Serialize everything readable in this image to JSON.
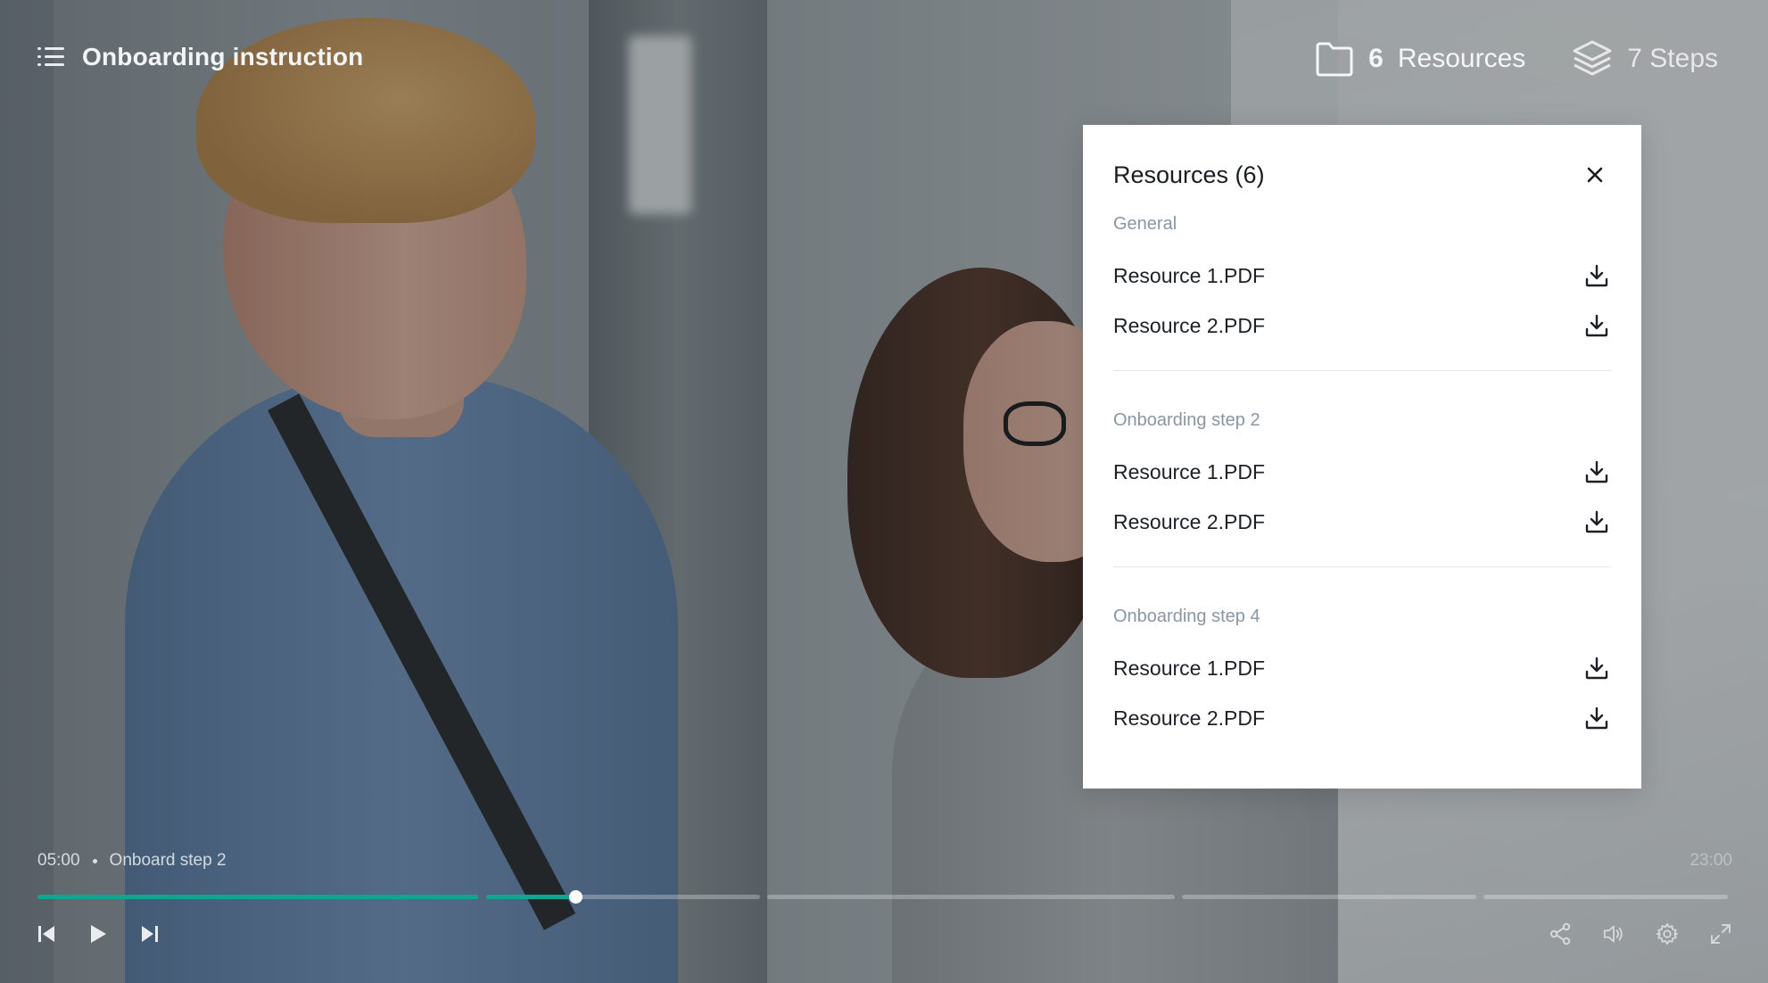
{
  "header": {
    "title": "Onboarding instruction",
    "resources_count": "6",
    "resources_label": "Resources",
    "steps_label": "7 Steps"
  },
  "panel": {
    "title": "Resources (6)",
    "groups": [
      {
        "label": "General",
        "items": [
          "Resource 1.PDF",
          "Resource 2.PDF"
        ]
      },
      {
        "label": "Onboarding step 2",
        "items": [
          "Resource 1.PDF",
          "Resource 2.PDF"
        ]
      },
      {
        "label": "Onboarding step 4",
        "items": [
          "Resource 1.PDF",
          "Resource 2.PDF"
        ]
      }
    ]
  },
  "player": {
    "current_time": "05:00",
    "current_step": "Onboard step 2",
    "total_time": "23:00",
    "steps_progress": [
      1.0,
      0.33,
      0,
      0,
      0,
      0
    ],
    "accent_color": "#10a58f"
  },
  "icons": {
    "menu": "list-icon",
    "resources": "folder-icon",
    "steps": "layers-icon",
    "close": "close-icon",
    "download": "download-icon",
    "prev": "skip-back-icon",
    "play": "play-icon",
    "next": "skip-forward-icon",
    "share": "share-icon",
    "volume": "volume-icon",
    "settings": "gear-icon",
    "fullscreen": "fullscreen-icon"
  }
}
